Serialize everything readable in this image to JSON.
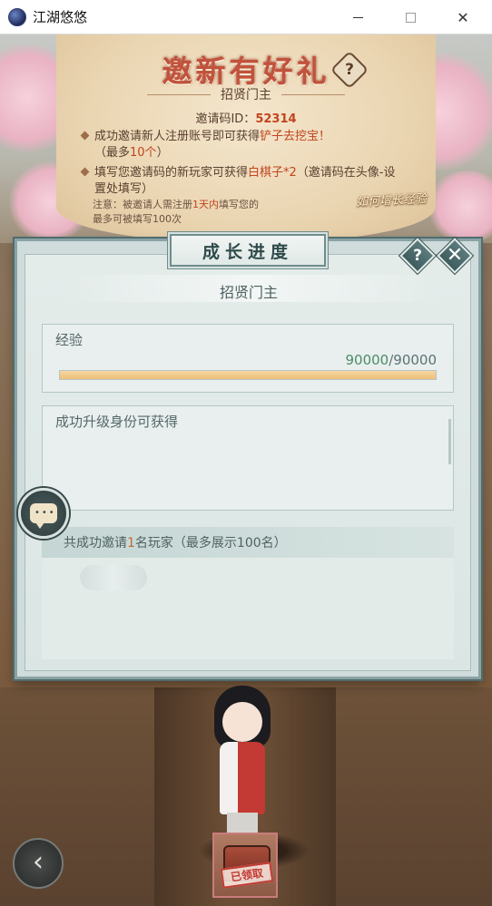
{
  "window": {
    "title": "江湖悠悠"
  },
  "invite": {
    "title": "邀新有好礼",
    "help_symbol": "?",
    "rank": "招贤门主",
    "code_label": "邀请码ID：",
    "code_value": "52314",
    "rule1_a": "成功邀请新人注册账号即可获得",
    "rule1_b": "铲子去挖宝！",
    "rule1_c": "（最多",
    "rule1_d": "10个",
    "rule1_e": "）",
    "rule2_a": "填写您邀请码的新玩家可获得",
    "rule2_b": "白棋子*2",
    "rule2_c": "（邀请码在头像-设置处填写）",
    "note_a": "注意：被邀请人需注册",
    "note_b": "1天内",
    "note_c": "填写您的",
    "note_d": "最多可被填写100次",
    "how_exp": "如何增长经验"
  },
  "dialog": {
    "title": "成长进度",
    "help_symbol": "?",
    "close_symbol": "✕",
    "rank": "招贤门主",
    "exp_label": "经验",
    "exp_current": "90000",
    "exp_separator": "/",
    "exp_max": "90000",
    "exp_progress": 1.0,
    "reward_label": "成功升级身份可获得",
    "invited_a": "共成功邀请",
    "invited_count": "1",
    "invited_b": "名玩家（最多展示100名）"
  },
  "chest": {
    "stamp": "已领取"
  },
  "icons": {
    "app": "app-icon",
    "chat": "chat-icon",
    "back": "back-arrow-icon"
  },
  "colors": {
    "accent_red": "#c1441e",
    "exp_fill": "#efbf79",
    "exp_value": "#4d8b67",
    "dialog_border": "#6f8d8e"
  }
}
